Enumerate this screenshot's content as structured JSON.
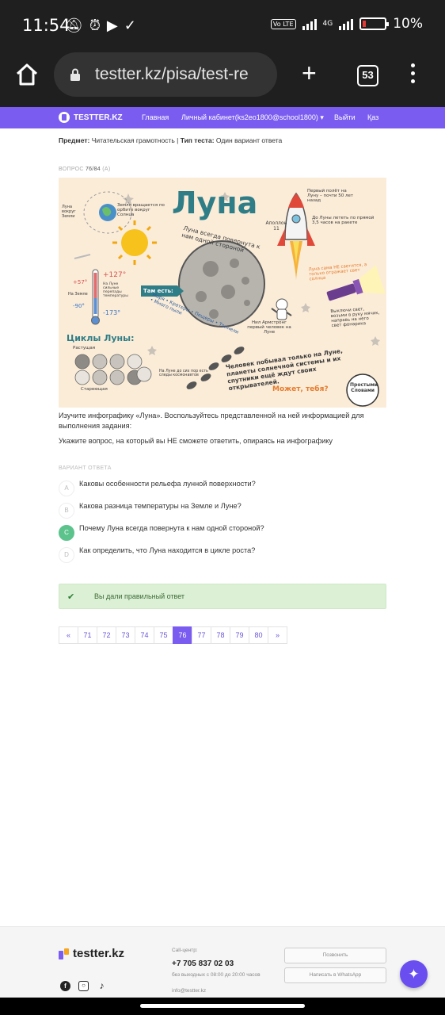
{
  "status": {
    "time": "11:54",
    "network": "4G",
    "volte": "Vo LTE",
    "battery": "10%"
  },
  "browser": {
    "url": "testter.kz/pisa/test-re",
    "tab_count": "53"
  },
  "nav": {
    "logo": "TESTTER.KZ",
    "home": "Главная",
    "cabinet": "Личный кабинет(ks2eo1800@school1800)",
    "logout": "Выйти",
    "lang": "Қаз"
  },
  "meta": {
    "subject_label": "Предмет:",
    "subject": "Читательская грамотность",
    "type_label": "Тип теста:",
    "type": "Один вариант ответа"
  },
  "question": {
    "label": "ВОПРОС",
    "number": "76/84",
    "suffix": "(A)",
    "text": "Изучите инфографику «Луна». Воспользуйтесь представленной на ней информацией для выполнения задания:",
    "prompt": "Укажите вопрос, на который вы НЕ сможете ответить, опираясь на инфографику"
  },
  "infographic": {
    "title": "Луна",
    "earth_rotates": "Земля вращается по орбите вокруг Солнца",
    "moon_around": "Луна вокруг Земли",
    "always_one_side": "Луна всегда повернута к нам одной стороной",
    "first_flight": "Первый полёт на Луну – почти 50 лет назад",
    "apollo": "Аполлон 11",
    "flight_time": "До Луны лететь по прямой 3,5 часов на ракете",
    "temp_hot": "+127°",
    "temp_earth_hot": "+57°",
    "temp_earth_label": "На Земле",
    "temp_earth_cold": "-90°",
    "temp_cold": "-173°",
    "temp_moon_label": "На Луне сильные перепады температуры",
    "there_is": "Там есть:",
    "features": "Моря • Кратеры • Пещеры • Тоннели • Много пыли",
    "armstrong": "Нил Армстронг первый человек на Луне",
    "no_light": "Луна сама НЕ светится, а только отражает свет солнца",
    "flashlight": "Выключи свет, возьми в руку мячик, направь на него свет фонарика",
    "cycles": "Циклы Луны:",
    "growing": "Растущая",
    "shrinking": "Стареющая",
    "footprints": "На Луне до сих пор есть следы космонавтов",
    "only_human": "Человек побывал только на Луне, планеты солнечной системы и их спутники ещё ждут своих открывателей.",
    "maybe_you": "Может, тебя?",
    "brand": "Простыми Словами"
  },
  "options_label": "ВАРИАНТ ОТВЕТА",
  "options": [
    {
      "letter": "A",
      "text": "Каковы особенности рельефа лунной поверхности?"
    },
    {
      "letter": "B",
      "text": "Какова разница температуры на Земле и Луне?"
    },
    {
      "letter": "C",
      "text": "Почему Луна всегда повернута к нам одной стороной?"
    },
    {
      "letter": "D",
      "text": "Как определить, что Луна находится в цикле роста?"
    }
  ],
  "selected_option": "C",
  "result": "Вы дали правильный ответ",
  "pagination": [
    "«",
    "71",
    "72",
    "73",
    "74",
    "75",
    "76",
    "77",
    "78",
    "79",
    "80",
    "»"
  ],
  "current_page": "76",
  "footer": {
    "logo": "testter.kz",
    "call_center_label": "Call-центр:",
    "phone": "+7 705 837 02 03",
    "hours": "без выходных с 08:00 до 20:00 часов",
    "email": "info@testter.kz",
    "call_button": "Позвонить",
    "whatsapp_button": "Написать в WhatsApp"
  },
  "colors": {
    "brand": "#7a5cf0",
    "success": "#5cc38c",
    "infographic_bg": "#fbecd8"
  }
}
